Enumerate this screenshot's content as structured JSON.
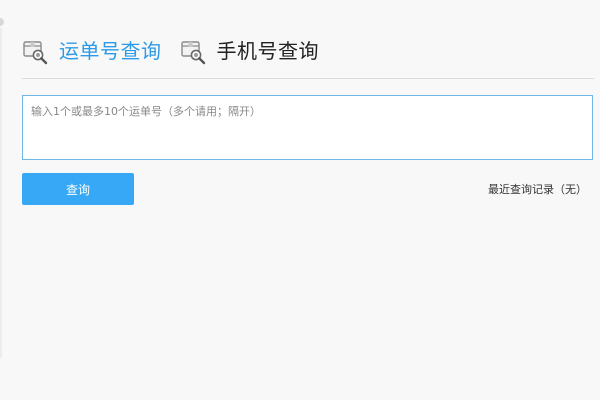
{
  "tabs": [
    {
      "label": "运单号查询",
      "icon": "package-search-icon",
      "active": true
    },
    {
      "label": "手机号查询",
      "icon": "package-search-icon",
      "active": false
    }
  ],
  "waybill_input": {
    "placeholder": "输入1个或最多10个运单号（多个请用；隔开）",
    "value": ""
  },
  "query_button": {
    "label": "查询"
  },
  "recent_records": {
    "text": "最近查询记录（无）"
  },
  "colors": {
    "accent": "#2c9ae6",
    "button": "#36a8f5",
    "input_border": "#6db8e6",
    "background": "#f8f8f8"
  }
}
